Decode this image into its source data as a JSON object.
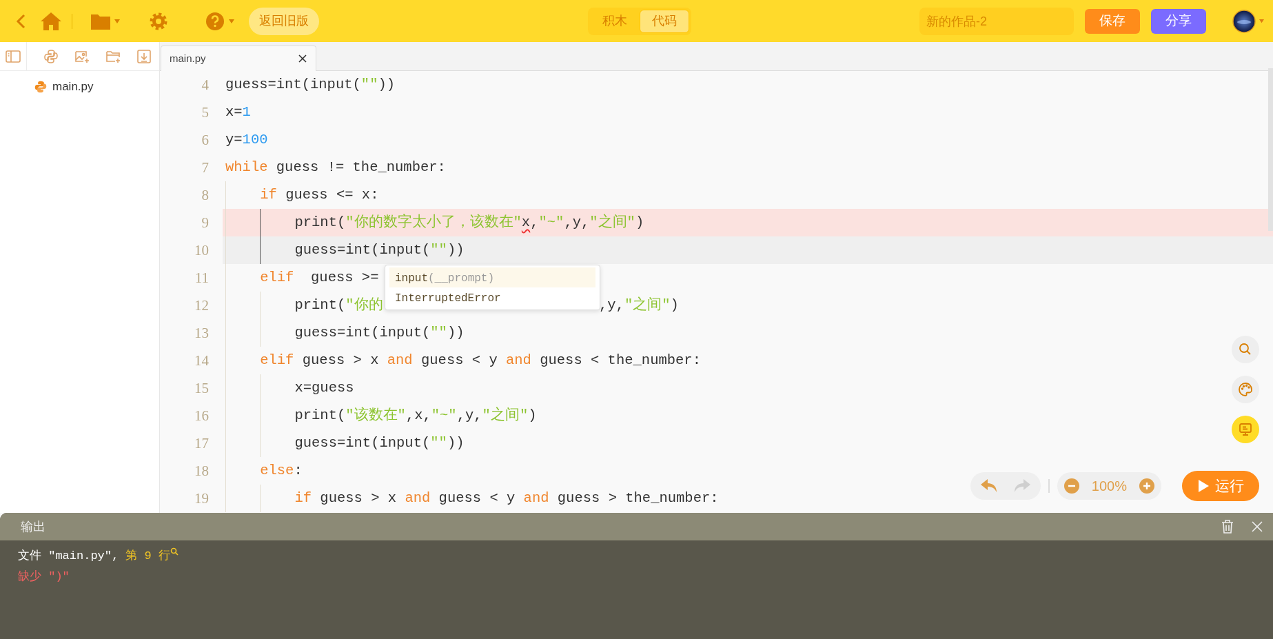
{
  "top_bar": {
    "old_version_button": "返回旧版",
    "mode_switch": [
      {
        "label": "积木",
        "selected": false
      },
      {
        "label": "代码",
        "selected": true
      }
    ],
    "project_name": {
      "value": "新的作品-2"
    },
    "actions": [
      {
        "label": "保存",
        "kind": "save"
      },
      {
        "label": "分享",
        "kind": "share"
      }
    ]
  },
  "file_tree": {
    "items": [
      {
        "name": "main.py"
      }
    ]
  },
  "editor": {
    "tabs": [
      {
        "label": "main.py",
        "selected": true
      }
    ],
    "lines": [
      {
        "number": "4",
        "tokens": [
          {
            "kind": "plain",
            "text": "guess=int(input("
          },
          {
            "kind": "string",
            "text": "\"\""
          },
          {
            "kind": "plain",
            "text": "))"
          }
        ]
      },
      {
        "number": "5",
        "tokens": [
          {
            "kind": "plain",
            "text": "x="
          },
          {
            "kind": "number",
            "text": "1"
          }
        ]
      },
      {
        "number": "6",
        "tokens": [
          {
            "kind": "plain",
            "text": "y="
          },
          {
            "kind": "number",
            "text": "100"
          }
        ]
      },
      {
        "number": "7",
        "tokens": [
          {
            "kind": "keyword",
            "text": "while"
          },
          {
            "kind": "plain",
            "text": " guess != the_number:"
          }
        ],
        "children": [
          {
            "number": "8",
            "tokens": [
              {
                "kind": "keyword",
                "text": "if"
              },
              {
                "kind": "plain",
                "text": " guess <= x:"
              }
            ],
            "children": [
              {
                "number": "9",
                "error": true,
                "tokens": [
                  {
                    "kind": "plain",
                    "text": "print("
                  },
                  {
                    "kind": "string",
                    "text": "\"你的数字太小了，该数在\""
                  },
                  {
                    "kind": "squiggle",
                    "text": "x"
                  },
                  {
                    "kind": "plain",
                    "text": ","
                  },
                  {
                    "kind": "string",
                    "text": "\"~\""
                  },
                  {
                    "kind": "plain",
                    "text": ",y,"
                  },
                  {
                    "kind": "string",
                    "text": "\"之间\""
                  },
                  {
                    "kind": "plain",
                    "text": ")"
                  }
                ]
              },
              {
                "number": "10",
                "current": true,
                "tokens": [
                  {
                    "kind": "plain",
                    "text": "guess=int(input("
                  },
                  {
                    "kind": "string",
                    "text": "\"\""
                  },
                  {
                    "kind": "plain",
                    "text": "))"
                  }
                ]
              }
            ]
          },
          {
            "number": "11",
            "tokens": [
              {
                "kind": "keyword",
                "text": "elif"
              },
              {
                "kind": "plain",
                "text": "  guess >="
              }
            ],
            "children": [
              {
                "number": "12",
                "tokens": [
                  {
                    "kind": "plain",
                    "text": "print("
                  },
                  {
                    "kind": "string",
                    "text": "\"你的"
                  },
                  {
                    "kind": "gap"
                  },
                  {
                    "kind": "plain",
                    "text": ",y,"
                  },
                  {
                    "kind": "string",
                    "text": "\"之间\""
                  },
                  {
                    "kind": "plain",
                    "text": ")"
                  }
                ]
              },
              {
                "number": "13",
                "tokens": [
                  {
                    "kind": "plain",
                    "text": "guess=int(input("
                  },
                  {
                    "kind": "string",
                    "text": "\"\""
                  },
                  {
                    "kind": "plain",
                    "text": "))"
                  }
                ]
              }
            ]
          },
          {
            "number": "14",
            "tokens": [
              {
                "kind": "keyword",
                "text": "elif"
              },
              {
                "kind": "plain",
                "text": " guess > x "
              },
              {
                "kind": "keyword",
                "text": "and"
              },
              {
                "kind": "plain",
                "text": " guess < y "
              },
              {
                "kind": "keyword",
                "text": "and"
              },
              {
                "kind": "plain",
                "text": " guess < the_number:"
              }
            ],
            "children": [
              {
                "number": "15",
                "tokens": [
                  {
                    "kind": "plain",
                    "text": "x=guess"
                  }
                ]
              },
              {
                "number": "16",
                "tokens": [
                  {
                    "kind": "plain",
                    "text": "print("
                  },
                  {
                    "kind": "string",
                    "text": "\"该数在\""
                  },
                  {
                    "kind": "plain",
                    "text": ",x,"
                  },
                  {
                    "kind": "string",
                    "text": "\"~\""
                  },
                  {
                    "kind": "plain",
                    "text": ",y,"
                  },
                  {
                    "kind": "string",
                    "text": "\"之间\""
                  },
                  {
                    "kind": "plain",
                    "text": ")"
                  }
                ]
              },
              {
                "number": "17",
                "tokens": [
                  {
                    "kind": "plain",
                    "text": "guess=int(input("
                  },
                  {
                    "kind": "string",
                    "text": "\"\""
                  },
                  {
                    "kind": "plain",
                    "text": "))"
                  }
                ]
              }
            ]
          },
          {
            "number": "18",
            "tokens": [
              {
                "kind": "keyword",
                "text": "else"
              },
              {
                "kind": "plain",
                "text": ":"
              }
            ],
            "children": [
              {
                "number": "19",
                "tokens": [
                  {
                    "kind": "keyword",
                    "text": "if"
                  },
                  {
                    "kind": "plain",
                    "text": " guess > x "
                  },
                  {
                    "kind": "keyword",
                    "text": "and"
                  },
                  {
                    "kind": "plain",
                    "text": " guess < y "
                  },
                  {
                    "kind": "keyword",
                    "text": "and"
                  },
                  {
                    "kind": "plain",
                    "text": " guess > the_number:"
                  }
                ]
              }
            ]
          }
        ]
      }
    ],
    "autocomplete": [
      {
        "label": "input",
        "detail": "(__prompt)",
        "selected": true
      },
      {
        "label": "InterruptedError",
        "selected": false
      }
    ],
    "side_tools": [
      {
        "kind": "search",
        "selected": false
      },
      {
        "kind": "palette",
        "selected": false
      },
      {
        "kind": "console",
        "selected": true
      }
    ],
    "undo": {
      "disabled": false
    },
    "redo": {
      "disabled": true
    },
    "zoom": "100%",
    "run_button": "运行"
  },
  "output": {
    "title": "输出",
    "lines": [
      {
        "segments": [
          {
            "kind": "plain",
            "text": "文件 \"main.py\", "
          },
          {
            "kind": "link",
            "text": "第 9 行"
          }
        ]
      },
      {
        "segments": [
          {
            "kind": "error",
            "text": "缺少 \")\""
          }
        ]
      }
    ]
  }
}
